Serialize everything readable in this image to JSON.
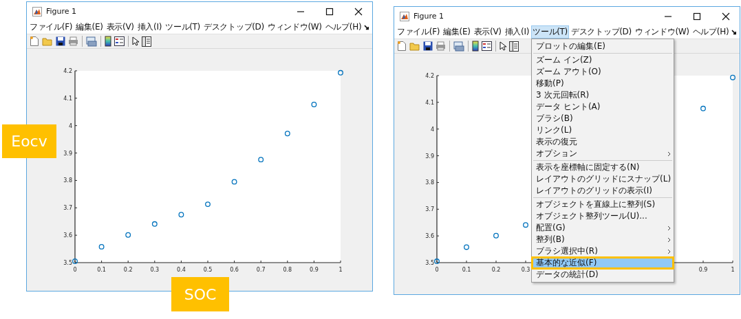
{
  "windows": [
    {
      "title": "Figure 1",
      "menus": [
        {
          "label": "ファイル(F)",
          "selected": false
        },
        {
          "label": "編集(E)",
          "selected": false
        },
        {
          "label": "表示(V)",
          "selected": false
        },
        {
          "label": "挿入(I)",
          "selected": false
        },
        {
          "label": "ツール(T)",
          "selected": false
        },
        {
          "label": "デスクトップ(D)",
          "selected": false
        },
        {
          "label": "ウィンドウ(W)",
          "selected": false
        },
        {
          "label": "ヘルプ(H)",
          "selected": false
        }
      ],
      "chart_data": {
        "type": "scatter",
        "x": [
          0,
          0.1,
          0.2,
          0.3,
          0.4,
          0.5,
          0.6,
          0.7,
          0.8,
          0.9,
          1
        ],
        "series": [
          {
            "color": "#0072bd",
            "values": [
              3.505,
              3.558,
              3.601,
              3.641,
              3.675,
              3.713,
              3.795,
              3.876,
              3.971,
              4.077,
              4.193
            ]
          }
        ],
        "xlim": [
          0,
          1
        ],
        "ylim": [
          3.5,
          4.2
        ],
        "xticks": [
          0,
          0.1,
          0.2,
          0.3,
          0.4,
          0.5,
          0.6,
          0.7,
          0.8,
          0.9,
          1
        ],
        "yticks": [
          3.5,
          3.6,
          3.7,
          3.8,
          3.9,
          4,
          4.1,
          4.2
        ]
      }
    },
    {
      "title": "Figure 1",
      "menus": [
        {
          "label": "ファイル(F)",
          "selected": false
        },
        {
          "label": "編集(E)",
          "selected": false
        },
        {
          "label": "表示(V)",
          "selected": false
        },
        {
          "label": "挿入(I)",
          "selected": false
        },
        {
          "label": "ツール(T)",
          "selected": true
        },
        {
          "label": "デスクトップ(D)",
          "selected": false
        },
        {
          "label": "ウィンドウ(W)",
          "selected": false
        },
        {
          "label": "ヘルプ(H)",
          "selected": false
        }
      ],
      "chart_data": {
        "type": "scatter",
        "x": [
          0,
          0.1,
          0.2,
          0.3,
          0.9,
          1
        ],
        "series": [
          {
            "color": "#0072bd",
            "values": [
              3.505,
              3.558,
              3.601,
              3.641,
              4.077,
              4.193
            ]
          }
        ],
        "xlim": [
          0,
          1
        ],
        "ylim": [
          3.5,
          4.2
        ],
        "xticks": [
          0,
          0.1,
          0.2,
          0.3,
          0.9,
          1
        ],
        "yticks": [
          3.5,
          3.6,
          3.7,
          3.8,
          3.9,
          4,
          4.1,
          4.2
        ]
      },
      "dropdown": {
        "groups": [
          [
            {
              "label": "プロットの編集(E)",
              "submenu": false,
              "selected": false
            }
          ],
          [
            {
              "label": "ズーム イン(Z)",
              "submenu": false,
              "selected": false
            },
            {
              "label": "ズーム アウト(O)",
              "submenu": false,
              "selected": false
            },
            {
              "label": "移動(P)",
              "submenu": false,
              "selected": false
            },
            {
              "label": "3 次元回転(R)",
              "submenu": false,
              "selected": false
            },
            {
              "label": "データ ヒント(A)",
              "submenu": false,
              "selected": false
            },
            {
              "label": "ブラシ(B)",
              "submenu": false,
              "selected": false
            },
            {
              "label": "リンク(L)",
              "submenu": false,
              "selected": false
            },
            {
              "label": "表示の復元",
              "submenu": false,
              "selected": false
            },
            {
              "label": "オプション",
              "submenu": true,
              "selected": false
            }
          ],
          [
            {
              "label": "表示を座標軸に固定する(N)",
              "submenu": false,
              "selected": false
            },
            {
              "label": "レイアウトのグリッドにスナップ(L)",
              "submenu": false,
              "selected": false
            },
            {
              "label": "レイアウトのグリッドの表示(I)",
              "submenu": false,
              "selected": false
            }
          ],
          [
            {
              "label": "オブジェクトを直線上に整列(S)",
              "submenu": false,
              "selected": false
            },
            {
              "label": "オブジェクト整列ツール(U)...",
              "submenu": false,
              "selected": false
            },
            {
              "label": "配置(G)",
              "submenu": true,
              "selected": false
            },
            {
              "label": "整列(B)",
              "submenu": true,
              "selected": false
            },
            {
              "label": "ブラシ選択中(R)",
              "submenu": true,
              "selected": false
            },
            {
              "label": "基本的な近似(F)",
              "submenu": false,
              "selected": true
            },
            {
              "label": "データの統計(D)",
              "submenu": false,
              "selected": false
            }
          ]
        ]
      }
    }
  ],
  "annotations": [
    {
      "text": "Eocv"
    },
    {
      "text": "SOC"
    }
  ]
}
